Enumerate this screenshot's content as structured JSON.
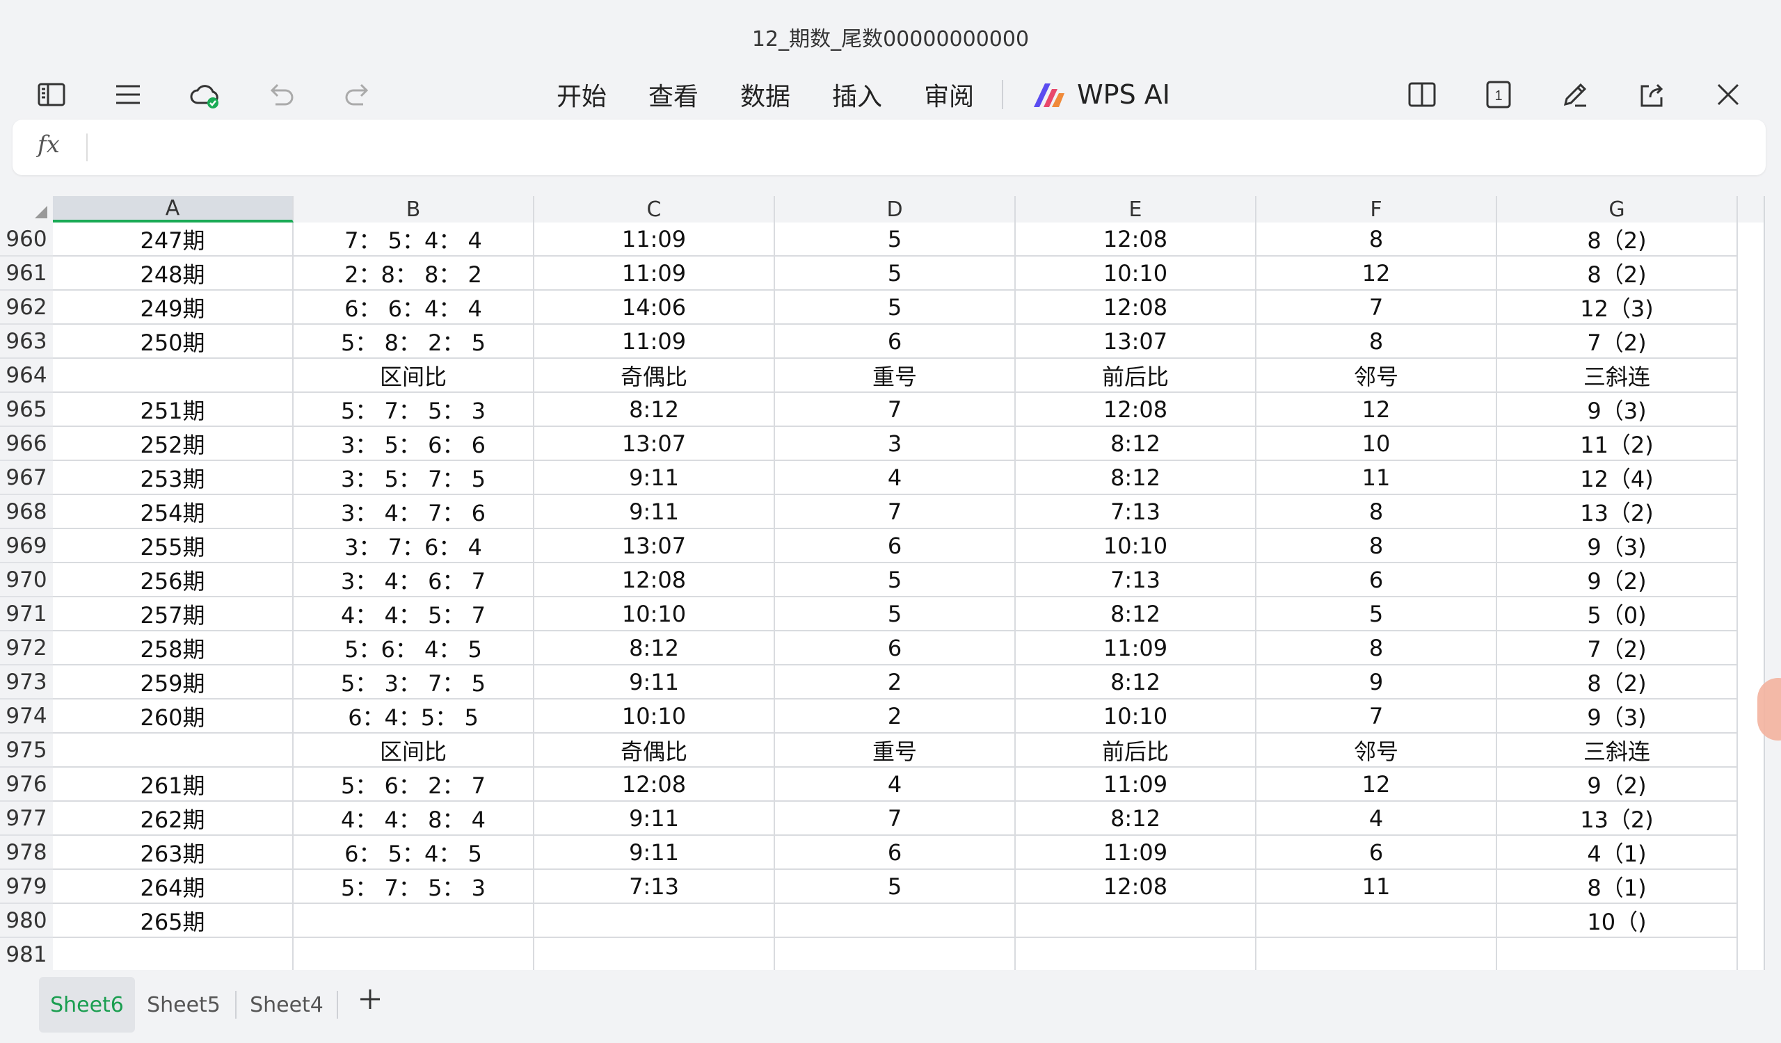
{
  "window": {
    "title": "12_期数_尾数00000000000"
  },
  "toolbar": {
    "menu": [
      "开始",
      "查看",
      "数据",
      "插入",
      "审阅"
    ],
    "ai_label": "WPS AI",
    "page_badge": "1"
  },
  "formula_bar": {
    "fx_label": "fx",
    "value": ""
  },
  "columns": [
    "A",
    "B",
    "C",
    "D",
    "E",
    "F",
    "G"
  ],
  "active_column": "A",
  "rows": [
    {
      "num": "960",
      "cells": [
        "247期",
        "7： 5：4： 4",
        "11:09",
        "5",
        "12:08",
        "8",
        "8（2)"
      ]
    },
    {
      "num": "961",
      "cells": [
        "248期",
        "2：8： 8： 2",
        "11:09",
        "5",
        "10:10",
        "12",
        "8（2)"
      ]
    },
    {
      "num": "962",
      "cells": [
        "249期",
        "6： 6：4： 4",
        "14:06",
        "5",
        "12:08",
        "7",
        "12（3)"
      ]
    },
    {
      "num": "963",
      "cells": [
        "250期",
        "5： 8： 2： 5",
        "11:09",
        "6",
        "13:07",
        "8",
        "7（2)"
      ]
    },
    {
      "num": "964",
      "cells": [
        "",
        "区间比",
        "奇偶比",
        "重号",
        "前后比",
        "邻号",
        "三斜连"
      ]
    },
    {
      "num": "965",
      "cells": [
        "251期",
        "5： 7： 5： 3",
        "8:12",
        "7",
        "12:08",
        "12",
        "9（3)"
      ]
    },
    {
      "num": "966",
      "cells": [
        "252期",
        "3： 5： 6： 6",
        "13:07",
        "3",
        "8:12",
        "10",
        "11（2)"
      ]
    },
    {
      "num": "967",
      "cells": [
        "253期",
        "3： 5： 7： 5",
        "9:11",
        "4",
        "8:12",
        "11",
        "12（4)"
      ]
    },
    {
      "num": "968",
      "cells": [
        "254期",
        "3： 4： 7： 6",
        "9:11",
        "7",
        "7:13",
        "8",
        "13（2)"
      ]
    },
    {
      "num": "969",
      "cells": [
        "255期",
        "3： 7：6： 4",
        "13:07",
        "6",
        "10:10",
        "8",
        "9（3)"
      ]
    },
    {
      "num": "970",
      "cells": [
        "256期",
        "3： 4： 6： 7",
        "12:08",
        "5",
        "7:13",
        "6",
        "9（2)"
      ]
    },
    {
      "num": "971",
      "cells": [
        "257期",
        "4： 4： 5： 7",
        "10:10",
        "5",
        "8:12",
        "5",
        "5（0)"
      ]
    },
    {
      "num": "972",
      "cells": [
        "258期",
        "5：6： 4： 5",
        "8:12",
        "6",
        "11:09",
        "8",
        "7（2)"
      ]
    },
    {
      "num": "973",
      "cells": [
        "259期",
        "5： 3： 7： 5",
        "9:11",
        "2",
        "8:12",
        "9",
        "8（2)"
      ]
    },
    {
      "num": "974",
      "cells": [
        "260期",
        "6：4：5： 5",
        "10:10",
        "2",
        "10:10",
        "7",
        "9（3)"
      ]
    },
    {
      "num": "975",
      "cells": [
        "",
        "区间比",
        "奇偶比",
        "重号",
        "前后比",
        "邻号",
        "三斜连"
      ]
    },
    {
      "num": "976",
      "cells": [
        "261期",
        "5： 6： 2： 7",
        "12:08",
        "4",
        "11:09",
        "12",
        "9（2)"
      ]
    },
    {
      "num": "977",
      "cells": [
        "262期",
        "4： 4： 8： 4",
        "9:11",
        "7",
        "8:12",
        "4",
        "13（2)"
      ]
    },
    {
      "num": "978",
      "cells": [
        "263期",
        "6： 5：4： 5",
        "9:11",
        "6",
        "11:09",
        "6",
        "4（1)"
      ]
    },
    {
      "num": "979",
      "cells": [
        "264期",
        "5： 7： 5： 3",
        "7:13",
        "5",
        "12:08",
        "11",
        "8（1)"
      ]
    },
    {
      "num": "980",
      "cells": [
        "265期",
        "",
        "",
        "",
        "",
        "",
        "10（)"
      ]
    },
    {
      "num": "981",
      "cells": [
        "",
        "",
        "",
        "",
        "",
        "",
        ""
      ]
    }
  ],
  "sheet_tabs": [
    "Sheet6",
    "Sheet5",
    "Sheet4"
  ],
  "active_tab": "Sheet6",
  "colors": {
    "accent": "#1aaa55",
    "cloud_ok": "#1aaa55"
  }
}
